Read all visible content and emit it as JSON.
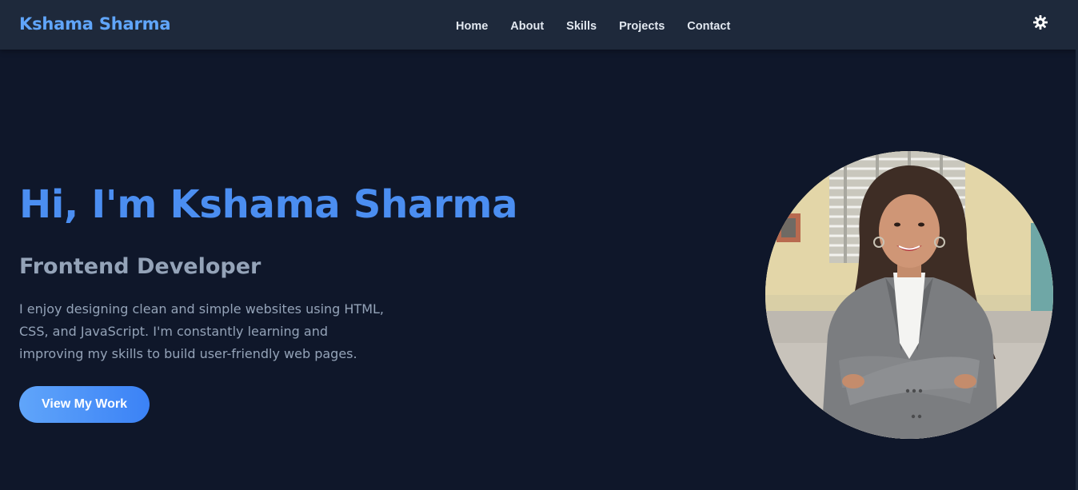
{
  "brand": {
    "name": "Kshama Sharma"
  },
  "nav": {
    "items": [
      {
        "label": "Home"
      },
      {
        "label": "About"
      },
      {
        "label": "Skills"
      },
      {
        "label": "Projects"
      },
      {
        "label": "Contact"
      }
    ],
    "theme_toggle_icon": "sun-gear-icon"
  },
  "hero": {
    "title": "Hi, I'm Kshama Sharma",
    "subtitle": "Frontend Developer",
    "description": "I enjoy designing clean and simple websites using HTML, CSS, and JavaScript. I'm constantly learning and improving my skills to build user-friendly web pages.",
    "cta_label": "View My Work"
  },
  "colors": {
    "background": "#0f172a",
    "navbar": "#1e293b",
    "accent": "#60a5fa",
    "title": "#4b8ef1",
    "muted_text": "#94a3b8"
  }
}
